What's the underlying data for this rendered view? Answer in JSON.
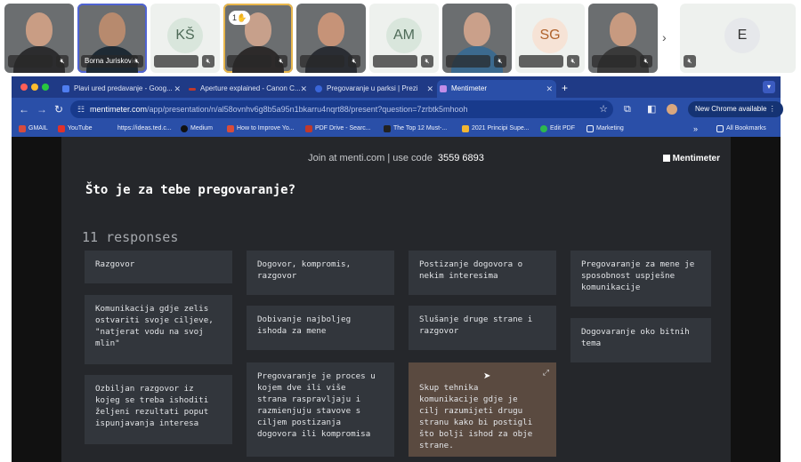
{
  "participants": [
    {
      "type": "video",
      "name": "",
      "muted": true
    },
    {
      "type": "video",
      "name": "Borna Juriskovic...",
      "muted": true,
      "active": true
    },
    {
      "type": "initials",
      "initials": "KŠ",
      "name": "",
      "muted": true,
      "bg": "#eef1ee",
      "fg": "#4e6b58"
    },
    {
      "type": "video",
      "name": "",
      "muted": true,
      "hand": "1",
      "hand_emoji": "✋"
    },
    {
      "type": "video",
      "name": "",
      "muted": true
    },
    {
      "type": "initials",
      "initials": "AM",
      "name": "",
      "muted": true,
      "bg": "#eef1ee",
      "fg": "#4e6b58"
    },
    {
      "type": "video",
      "name": "",
      "muted": true
    },
    {
      "type": "initials",
      "initials": "SG",
      "name": "",
      "muted": true,
      "bg": "#eef1ee",
      "fg": "#b0632c"
    },
    {
      "type": "video",
      "name": "",
      "muted": true
    },
    {
      "type": "initials",
      "initials": "E",
      "name": "",
      "muted": true,
      "bg": "#eef1ee",
      "fg": "#333333"
    }
  ],
  "strip_next_icon": "chevron-right-icon",
  "browser": {
    "tabs": [
      {
        "label": "Plavi ured predavanje - Goog...",
        "icon_color": "#4f7ef0"
      },
      {
        "label": "Aperture explained - Canon C...",
        "icon_color": "#c0392b"
      },
      {
        "label": "Pregovaranje u parksi | Prezi",
        "icon_color": "#3a66d9"
      },
      {
        "label": "Mentimeter",
        "icon_color": "#c08de8",
        "active": true
      }
    ],
    "new_tab": "+",
    "url_host": "mentimeter.com",
    "url_path": "/app/presentation/n/al58ovnhv6g8b5a95n1bkarru4nqrt88/present?question=7zrbtk5mhooh",
    "chrome_available": "New Chrome available",
    "bookmarks": [
      {
        "label": "GMAIL",
        "color": "#d64b3d"
      },
      {
        "label": "YouTube",
        "color": "#e0312b"
      },
      {
        "label": "https://ideas.ted.c...",
        "color": "#2a4fa8"
      },
      {
        "label": "Medium",
        "color": "#111111"
      },
      {
        "label": "How to Improve Yo...",
        "color": "#d94c3a"
      },
      {
        "label": "PDF Drive - Searc...",
        "color": "#c0392b"
      },
      {
        "label": "The Top 12 Must-...",
        "color": "#222222"
      },
      {
        "label": "2021 Principi Supe...",
        "color": "#f2b632"
      },
      {
        "label": "Edit PDF",
        "color": "#2db84e"
      },
      {
        "label": "Marketing",
        "color": "#2a4fa8"
      }
    ],
    "bookmarks_more": "»",
    "all_bookmarks": "All Bookmarks"
  },
  "slide": {
    "join_text": "Join at menti.com | use code",
    "code": "3559 6893",
    "brand": "Mentimeter",
    "question": "Što je za tebe pregovaranje?",
    "responses_count": "11 responses",
    "responses": [
      "Razgovor",
      "Komunikacija gdje zelis\nostvariti svoje ciljeve,\n\"natjerat vodu na svoj\nmlin\"",
      "Ozbiljan razgovor iz\nkojeg se treba ishoditi\nželjeni rezultati poput\nispunjavanja interesa",
      "Dogovor, kompromis,\nrazgovor",
      "Dobivanje najboljeg\nishoda za mene",
      "Pregovaranje je proces u\nkojem dve ili više\nstrana raspravljaju i\nrazmienjuju stavove s\nciljem postizanja\ndogovora ili kompromisa",
      "Postizanje dogovora o\nnekim interesima",
      "Slušanje druge strane i\nrazgovor",
      "Skup tehnika\nkomunikacije gdje je\ncilj razumijeti drugu\nstranu kako bi postigli\nšto bolji ishod za obje\nstrane.",
      "Pregovaranje za mene je\nsposobnost uspješne\nkomunikacije",
      "Dogovaranje oko bitnih\ntema"
    ]
  }
}
